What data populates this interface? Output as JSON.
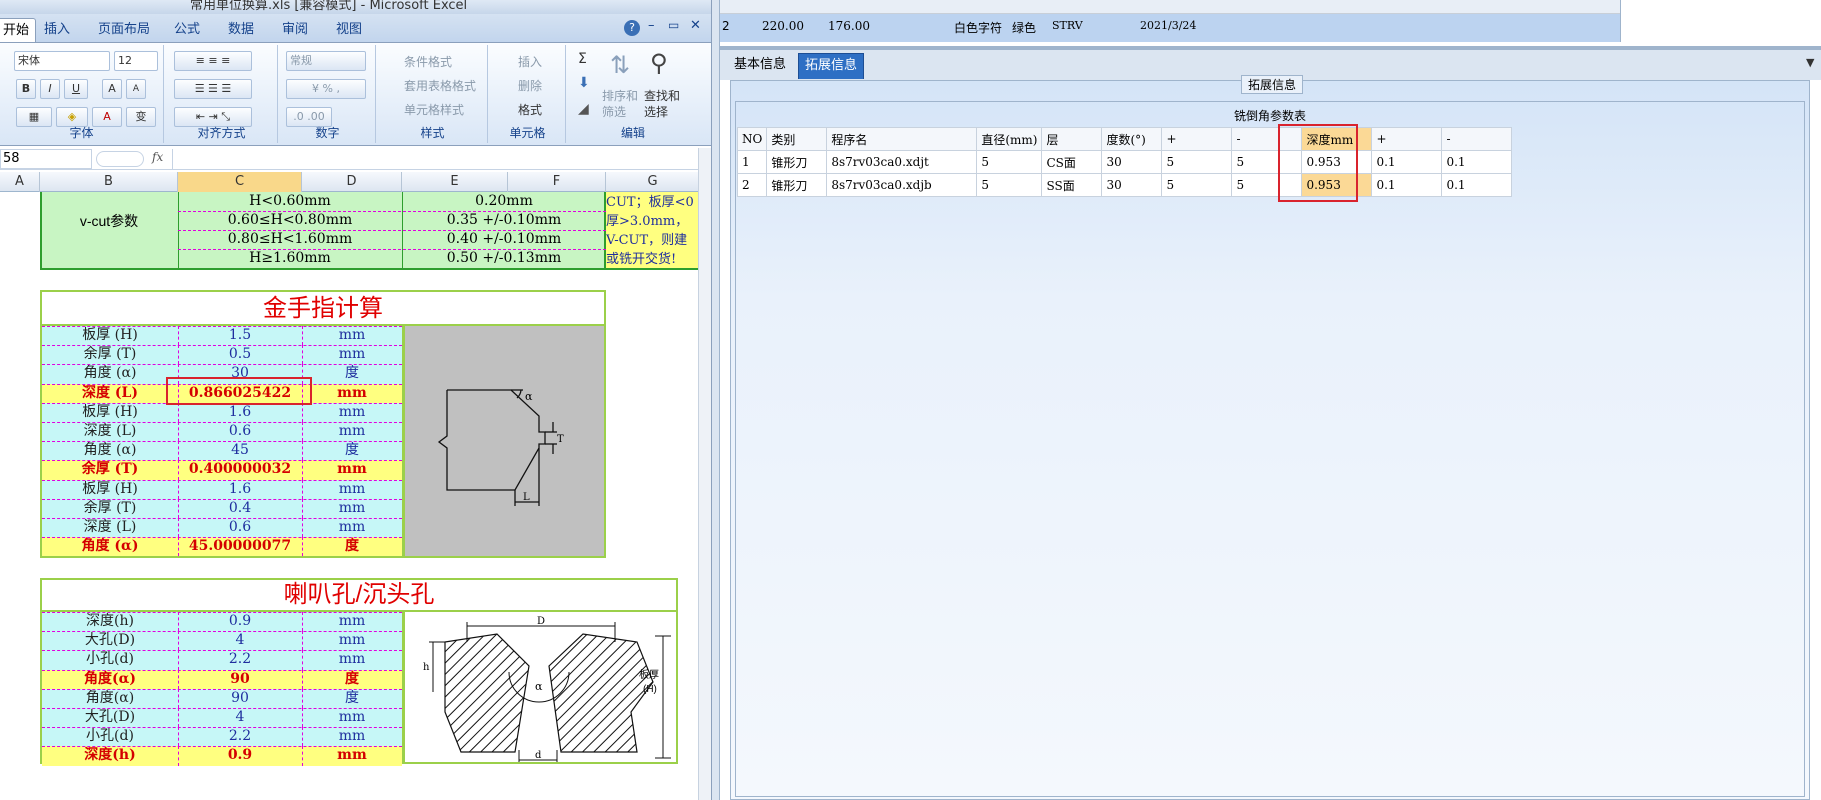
{
  "excel": {
    "window_title": "常用单位换算.xls [兼容模式] - Microsoft Excel",
    "window_buttons": [
      "?",
      "–",
      "▭",
      "✕"
    ],
    "tabs": [
      "开始",
      "插入",
      "页面布局",
      "公式",
      "数据",
      "审阅",
      "视图"
    ],
    "ribbon": {
      "font_name": "宋体",
      "font_size": "12",
      "number_format": "常规",
      "styles": [
        "条件格式",
        "套用表格格式",
        "单元格样式"
      ],
      "cells": [
        "插入",
        "删除",
        "格式"
      ],
      "editing": [
        "排序和筛选",
        "查找和选择"
      ],
      "sort_label_1": "排序和",
      "sort_label_2": "筛选",
      "find_label_1": "查找和",
      "find_label_2": "选择",
      "groups": [
        "字体",
        "对齐方式",
        "数字",
        "样式",
        "单元格",
        "编辑"
      ],
      "font_buttons": [
        "B",
        "I",
        "U",
        "A",
        "A"
      ]
    },
    "name_box": "58",
    "fx": "fx",
    "columns": [
      "A",
      "B",
      "C",
      "D",
      "E",
      "F",
      "G"
    ],
    "vcut": {
      "label": "v-cut参数",
      "rows": [
        {
          "c": "H<0.60mm",
          "e": "0.20mm"
        },
        {
          "c": "0.60≤H<0.80mm",
          "e": "0.35 +/-0.10mm"
        },
        {
          "c": "0.80≤H<1.60mm",
          "e": "0.40 +/-0.10mm"
        },
        {
          "c": "H≥1.60mm",
          "e": "0.50 +/-0.13mm"
        }
      ],
      "note": [
        "CUT；板厚<0",
        "厚>3.0mm，",
        "V-CUT，则建",
        "或铣开交货!"
      ]
    },
    "gold": {
      "title": "金手指计算",
      "rows": [
        {
          "name": "板厚 (H)",
          "value": "1.5",
          "unit": "mm",
          "hl": false
        },
        {
          "name": "余厚 (T)",
          "value": "0.5",
          "unit": "mm",
          "hl": false
        },
        {
          "name": "角度 (α)",
          "value": "30",
          "unit": "度",
          "hl": false
        },
        {
          "name": "深度 (L)",
          "value": "0.866025422",
          "unit": "mm",
          "hl": true
        },
        {
          "name": "板厚 (H)",
          "value": "1.6",
          "unit": "mm",
          "hl": false
        },
        {
          "name": "深度 (L)",
          "value": "0.6",
          "unit": "mm",
          "hl": false
        },
        {
          "name": "角度 (α)",
          "value": "45",
          "unit": "度",
          "hl": false
        },
        {
          "name": "余厚 (T)",
          "value": "0.400000032",
          "unit": "mm",
          "hl": true
        },
        {
          "name": "板厚 (H)",
          "value": "1.6",
          "unit": "mm",
          "hl": false
        },
        {
          "name": "余厚 (T)",
          "value": "0.4",
          "unit": "mm",
          "hl": false
        },
        {
          "name": "深度 (L)",
          "value": "0.6",
          "unit": "mm",
          "hl": false
        },
        {
          "name": "角度 (α)",
          "value": "45.00000077",
          "unit": "度",
          "hl": true
        }
      ],
      "diagram_labels": {
        "alpha": "α",
        "t": "T",
        "l": "L"
      }
    },
    "horn": {
      "title": "喇叭孔/沉头孔",
      "rows": [
        {
          "name": "深度(h)",
          "value": "0.9",
          "unit": "mm",
          "hl": false
        },
        {
          "name": "大孔(D)",
          "value": "4",
          "unit": "mm",
          "hl": false
        },
        {
          "name": "小孔(d)",
          "value": "2.2",
          "unit": "mm",
          "hl": false
        },
        {
          "name": "角度(α)",
          "value": "90",
          "unit": "度",
          "hl": true
        },
        {
          "name": "角度(α)",
          "value": "90",
          "unit": "度",
          "hl": false
        },
        {
          "name": "大孔(D)",
          "value": "4",
          "unit": "mm",
          "hl": false
        },
        {
          "name": "小孔(d)",
          "value": "2.2",
          "unit": "mm",
          "hl": false
        },
        {
          "name": "深度(h)",
          "value": "0.9",
          "unit": "mm",
          "hl": true
        }
      ],
      "diagram_labels": {
        "D": "D",
        "d": "d",
        "h": "h",
        "alpha": "α",
        "thick": "板厚",
        "H": "(H)"
      }
    }
  },
  "app": {
    "top_row": {
      "index": "2",
      "values": [
        "220.00",
        "176.00",
        "白色字符",
        "绿色",
        "STRV",
        "2021/3/24"
      ]
    },
    "tabs": [
      "基本信息",
      "拓展信息"
    ],
    "active_tab": "拓展信息",
    "group_title": "拓展信息",
    "table_title": "铣倒角参数表",
    "columns": [
      "NO",
      "类别",
      "程序名",
      "直径(mm)",
      "层",
      "度数(°)",
      "+",
      "-",
      "深度mm",
      "+",
      "-"
    ],
    "rows": [
      [
        "1",
        "锥形刀",
        "8s7rv03ca0.xdjt",
        "5",
        "CS面",
        "30",
        "5",
        "5",
        "0.953",
        "0.1",
        "0.1"
      ],
      [
        "2",
        "锥形刀",
        "8s7rv03ca0.xdjb",
        "5",
        "SS面",
        "30",
        "5",
        "5",
        "0.953",
        "0.1",
        "0.1"
      ]
    ],
    "chevron": "▼",
    "highlight_color": "#d9232d"
  }
}
